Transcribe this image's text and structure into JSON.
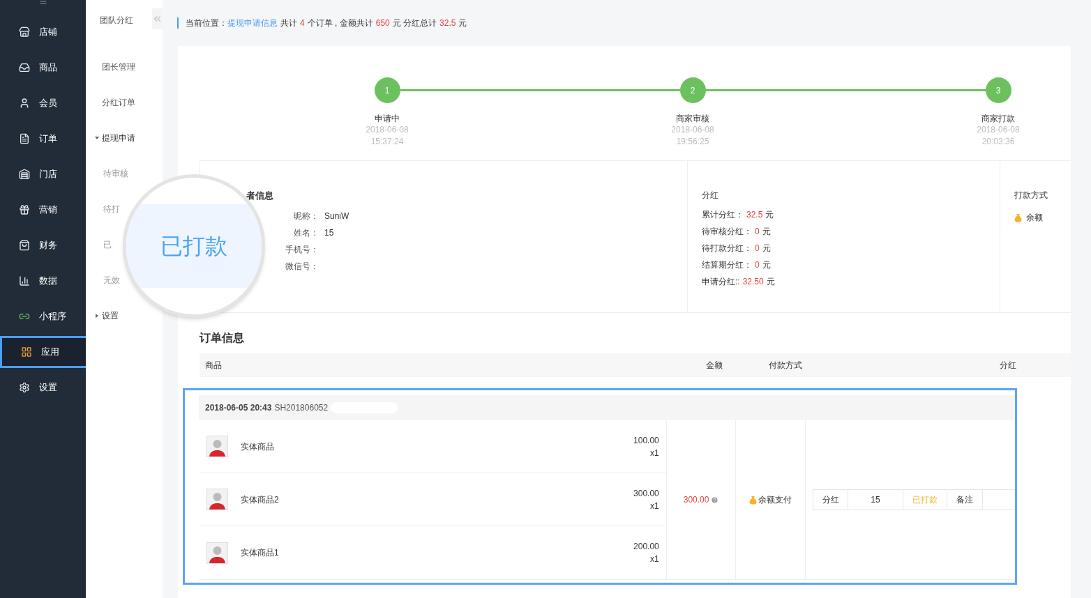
{
  "sidebar": {
    "items": [
      {
        "label": "店铺",
        "selected": false
      },
      {
        "label": "商品",
        "selected": false
      },
      {
        "label": "会员",
        "selected": false
      },
      {
        "label": "订单",
        "selected": false
      },
      {
        "label": "门店",
        "selected": false
      },
      {
        "label": "营销",
        "selected": false
      },
      {
        "label": "财务",
        "selected": false
      },
      {
        "label": "数据",
        "selected": false
      },
      {
        "label": "小程序",
        "selected": false
      },
      {
        "label": "应用",
        "selected": true
      },
      {
        "label": "设置",
        "selected": false
      }
    ]
  },
  "submenu": {
    "title": "团队分红",
    "items": [
      {
        "label": "团长管理"
      },
      {
        "label": "分红订单"
      },
      {
        "label": "提现申请",
        "expanded": true,
        "children": [
          {
            "label": "待审核"
          },
          {
            "label": "待打"
          },
          {
            "label": "已"
          },
          {
            "label": "无效"
          }
        ]
      },
      {
        "label": "设置",
        "expanded": false
      }
    ]
  },
  "magnifier": {
    "text": "已打款"
  },
  "breadcrumb": {
    "label": "当前位置：",
    "link": "提现申请信息",
    "summary": [
      {
        "text": "共计",
        "kind": "plain"
      },
      {
        "text": "4",
        "kind": "number"
      },
      {
        "text": "个订单 , 金额共计",
        "kind": "plain"
      },
      {
        "text": "650",
        "kind": "number"
      },
      {
        "text": "元 分红总计",
        "kind": "plain"
      },
      {
        "text": "32.5",
        "kind": "number"
      },
      {
        "text": "元",
        "kind": "plain"
      }
    ]
  },
  "steps": [
    {
      "number": "1",
      "label": "申请中",
      "date": "2018-06-08",
      "time": "15:37:24"
    },
    {
      "number": "2",
      "label": "商家审核",
      "date": "2018-06-08",
      "time": "19:56:25"
    },
    {
      "number": "3",
      "label": "商家打款",
      "date": "2018-06-08",
      "time": "20:03:36"
    }
  ],
  "applicant": {
    "title": "者信息",
    "fields": [
      {
        "label": "昵称：",
        "value": "SuniW"
      },
      {
        "label": "姓名：",
        "value": "15"
      },
      {
        "label": "手机号："
      },
      {
        "label": "微信号："
      }
    ]
  },
  "dividend": {
    "title": "分红",
    "rows": [
      {
        "label": "累计分红：",
        "value": "32.5",
        "unit": "元"
      },
      {
        "label": "待审核分红：",
        "value": "0",
        "unit": "元"
      },
      {
        "label": "待打款分红：",
        "value": "0",
        "unit": "元"
      },
      {
        "label": "结算期分红：",
        "value": "0",
        "unit": "元"
      },
      {
        "label": "申请分红::",
        "value": "32.50",
        "unit": "元"
      }
    ]
  },
  "payout": {
    "title": "打款方式",
    "method": "余额"
  },
  "orders": {
    "title": "订单信息",
    "columns": [
      "商品",
      "金额",
      "付款方式",
      "分红"
    ],
    "order": {
      "date": "2018-06-05 20:43",
      "number": "SH201806052",
      "items": [
        {
          "name": "实体商品",
          "price": "100.00",
          "qty": "x1"
        },
        {
          "name": "实体商品2",
          "price": "300.00",
          "qty": "x1"
        },
        {
          "name": "实体商品1",
          "price": "200.00",
          "qty": "x1"
        }
      ],
      "amount": "300.00",
      "payment": "余额支付",
      "dividend": {
        "label": "分红",
        "value": "15",
        "status": "已打款",
        "note": "备注"
      }
    }
  }
}
